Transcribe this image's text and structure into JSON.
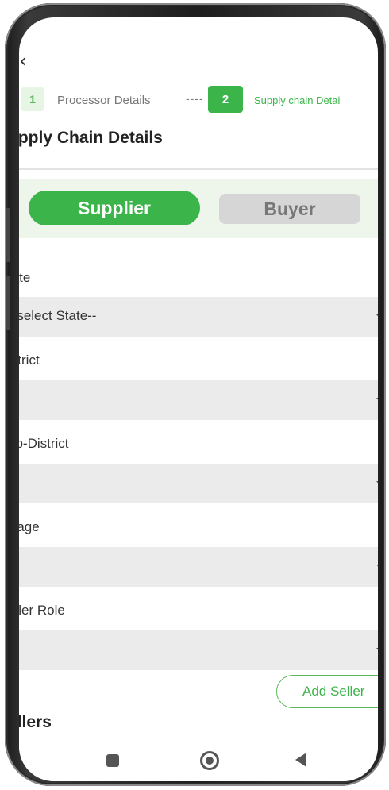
{
  "header": {
    "back_icon": "back-arrow-icon"
  },
  "stepper": {
    "step1_number": "1",
    "step1_label": "Processor Details",
    "connector": "----",
    "step2_number": "2",
    "step2_label": "Supply chain Detai"
  },
  "page": {
    "title": "upply Chain Details"
  },
  "toggle": {
    "supplier_label": "Supplier",
    "buyer_label": "Buyer"
  },
  "form": {
    "state_label": "tate",
    "state_value": "--select State--",
    "district_label": "istrict",
    "subdistrict_label": "ub-District",
    "village_label": "illage",
    "seller_role_label": "eller Role"
  },
  "actions": {
    "add_seller_label": "Add Seller"
  },
  "sellers": {
    "heading": "ellers"
  },
  "colors": {
    "accent": "#3bb54a",
    "toggle_bg": "#eef6ec",
    "field_bg": "#ebebeb",
    "inactive_tab": "#d6d6d6"
  }
}
